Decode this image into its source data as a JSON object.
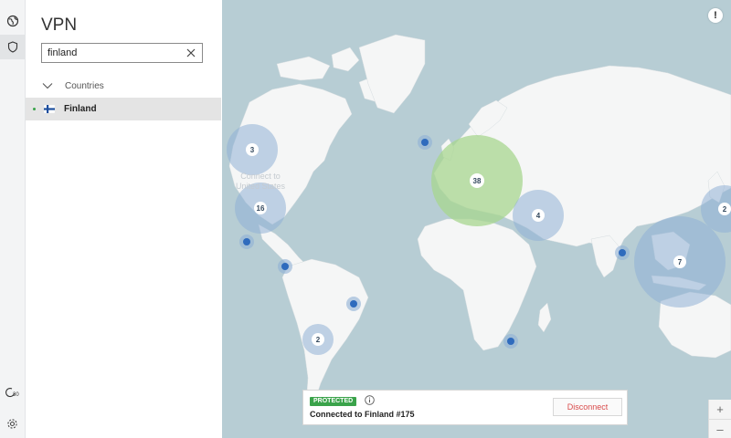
{
  "rail": {
    "top_icons": [
      "globe-icon",
      "shield-icon"
    ],
    "bottom_icons": [
      "timer-30-icon",
      "gear-icon"
    ]
  },
  "panel": {
    "title": "VPN",
    "search": {
      "value": "finland",
      "placeholder": ""
    },
    "group_label": "Countries",
    "country": {
      "name": "Finland",
      "status_color": "#3aa34a",
      "flag": "finland-flag-icon"
    }
  },
  "map": {
    "help_label": "!",
    "faded_label_line1": "Connect to",
    "faded_label_line2": "United States",
    "clusters": [
      {
        "label": "3"
      },
      {
        "label": "16"
      },
      {
        "label": "38"
      },
      {
        "label": "4"
      },
      {
        "label": "7"
      },
      {
        "label": "2"
      },
      {
        "label": "2"
      }
    ],
    "colors": {
      "ocean": "#b7cdd4",
      "land": "#f5f6f6",
      "cluster_blue": "#8fb0d6",
      "cluster_green": "#a7d58f"
    }
  },
  "status": {
    "badge": "PROTECTED",
    "badge_color": "#3aa34a",
    "connection_text": "Connected to Finland #175",
    "disconnect_label": "Disconnect"
  },
  "zoom": {
    "in_label": "+",
    "out_label": "–"
  }
}
